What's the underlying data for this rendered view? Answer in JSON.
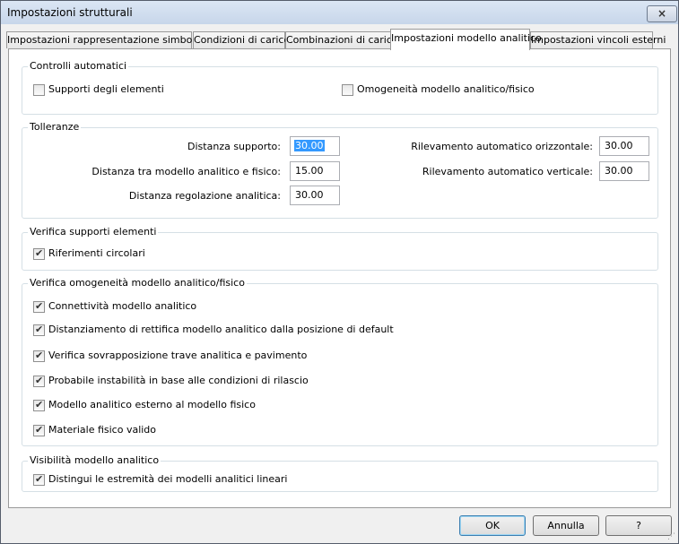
{
  "window": {
    "title": "Impostazioni strutturali",
    "close_label": "×"
  },
  "tabs": [
    {
      "label": "Impostazioni rappresentazione simbolica"
    },
    {
      "label": "Condizioni di carico"
    },
    {
      "label": "Combinazioni di carichi"
    },
    {
      "label": "Impostazioni modello analitico"
    },
    {
      "label": "Impostazioni vincoli esterni"
    }
  ],
  "active_tab": "Impostazioni modello analitico",
  "controlli": {
    "title": "Controlli automatici",
    "supporti": {
      "label": "Supporti degli elementi",
      "checked": false
    },
    "omogeneita": {
      "label": "Omogeneità modello analitico/fisico",
      "checked": false
    }
  },
  "tolleranze": {
    "title": "Tolleranze",
    "distanza_supporto": {
      "label": "Distanza supporto:",
      "value": "30.00"
    },
    "distanza_modello": {
      "label": "Distanza tra modello analitico e fisico:",
      "value": "15.00"
    },
    "distanza_regolazione": {
      "label": "Distanza regolazione analitica:",
      "value": "30.00"
    },
    "rilevamento_orizzontale": {
      "label": "Rilevamento automatico orizzontale:",
      "value": "30.00"
    },
    "rilevamento_verticale": {
      "label": "Rilevamento automatico verticale:",
      "value": "30.00"
    }
  },
  "verifica_supporti": {
    "title": "Verifica supporti elementi",
    "riferimenti": {
      "label": "Riferimenti circolari",
      "checked": true
    }
  },
  "verifica_omogeneita": {
    "title": "Verifica omogeneità modello analitico/fisico",
    "items": [
      {
        "label": "Connettività modello analitico",
        "checked": true
      },
      {
        "label": "Distanziamento di rettifica modello analitico dalla posizione di default",
        "checked": true
      },
      {
        "label": "Verifica sovrapposizione trave analitica e pavimento",
        "checked": true
      },
      {
        "label": "Probabile instabilità in base alle condizioni di rilascio",
        "checked": true
      },
      {
        "label": "Modello analitico esterno al modello fisico",
        "checked": true
      },
      {
        "label": "Materiale fisico valido",
        "checked": true
      }
    ]
  },
  "visibilita": {
    "title": "Visibilità modello analitico",
    "estremita": {
      "label": "Distingui le estremità dei modelli analitici lineari",
      "checked": true
    }
  },
  "buttons": {
    "ok": "OK",
    "cancel": "Annulla",
    "help": "?"
  },
  "check_glyph": "✔"
}
